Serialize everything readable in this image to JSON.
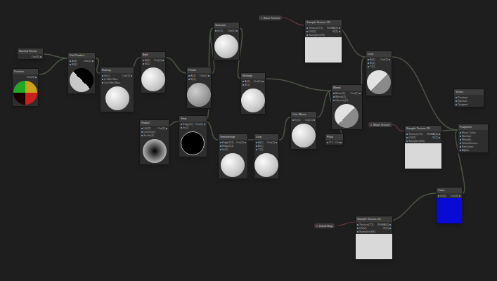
{
  "graph": {
    "nodes": [
      {
        "title": "Normal Vector",
        "ports": [],
        "outputs": [
          "Out(3)"
        ],
        "preview": "none"
      },
      {
        "title": "Position",
        "ports": [],
        "outputs": [
          "Out(3)"
        ],
        "preview": "sphere-color"
      },
      {
        "title": "Dot Product",
        "ports": [
          "A(3)",
          "B(3)"
        ],
        "outputs": [
          "Out(1)"
        ],
        "preview": "sphere-dark-split"
      },
      {
        "title": "Remap",
        "ports": [
          "In(1)",
          "In Min Max",
          "Out Min Max"
        ],
        "outputs": [
          "Out(1)"
        ],
        "preview": "sphere-light"
      },
      {
        "title": "Add",
        "ports": [
          "A(1)",
          "B(1)"
        ],
        "outputs": [
          "Out(1)"
        ],
        "preview": "sphere-light"
      },
      {
        "title": "Power",
        "ports": [
          "A(1)",
          "B(1)"
        ],
        "outputs": [
          "Out(1)"
        ],
        "preview": "sphere-gray"
      },
      {
        "title": "Saturate",
        "ports": [
          "In(1)"
        ],
        "outputs": [
          "Out(1)"
        ],
        "preview": "sphere-light"
      },
      {
        "title": "Multiply",
        "ports": [
          "A(1)",
          "B(1)"
        ],
        "outputs": [
          "Out(1)"
        ],
        "preview": "sphere-light"
      },
      {
        "title": "Radial",
        "ports": [
          "UV(2)",
          "Center(2)",
          "Scale(1)"
        ],
        "outputs": [
          "Out(1)"
        ],
        "preview": "sphere-radial"
      },
      {
        "title": "Step",
        "ports": [
          "Edge(1)",
          "In(1)"
        ],
        "outputs": [
          "Out(1)"
        ],
        "preview": "sphere-black"
      },
      {
        "title": "Smoothstep",
        "ports": [
          "Edge1(1)",
          "Edge2(1)",
          "In(1)"
        ],
        "outputs": [
          "Out(1)"
        ],
        "preview": "sphere-light"
      },
      {
        "title": "Lerp",
        "ports": [
          "A(1)",
          "B(1)",
          "T(1)"
        ],
        "outputs": [
          "Out(1)"
        ],
        "preview": "sphere-light"
      },
      {
        "title": "One Minus",
        "ports": [
          "In(1)"
        ],
        "outputs": [
          "Out(1)"
        ],
        "preview": "sphere-light"
      },
      {
        "title": "Float",
        "ports": [
          "X 1"
        ],
        "outputs": [
          "Out"
        ],
        "preview": "none"
      },
      {
        "title": "Blend",
        "ports": [
          "Base(1)",
          "Blend(1)",
          "Opacity(1)"
        ],
        "outputs": [
          "Out(1)"
        ],
        "preview": "sphere-light-split"
      },
      {
        "title": "Lerp",
        "ports": [
          "A(1)",
          "B(1)",
          "T(1)"
        ],
        "outputs": [
          "Out(1)"
        ],
        "preview": "sphere-light-split"
      },
      {
        "title": "Sample Texture 2D",
        "ports": [
          "Texture(T2)",
          "UV(2)",
          "Sampler(SS)"
        ],
        "outputs": [
          "RGBA(4)",
          "R(1)"
        ],
        "preview": "texture"
      },
      {
        "title": "Sample Texture 2D",
        "ports": [
          "Texture(T2)",
          "UV(2)",
          "Sampler(SS)"
        ],
        "outputs": [
          "RGBA(4)",
          "R(1)"
        ],
        "preview": "texture"
      },
      {
        "title": "Sample Texture 2D",
        "ports": [
          "Texture(T2)",
          "UV(2)",
          "Sampler(SS)"
        ],
        "outputs": [
          "RGBA(4)",
          "R(1)"
        ],
        "preview": "texture"
      },
      {
        "title": "Color",
        "ports": [
          "In(4)"
        ],
        "outputs": [
          "Out(4)"
        ],
        "preview": "swatch",
        "color": "#0a0ad6"
      },
      {
        "title": "Fragment",
        "ports": [
          "Base Color",
          "Normal",
          "Metallic",
          "Smoothness",
          "Emission",
          "Alpha"
        ],
        "outputs": [],
        "preview": "none"
      },
      {
        "title": "Vertex",
        "ports": [
          "Position",
          "Normal",
          "Tangent"
        ],
        "outputs": [],
        "preview": "none"
      }
    ],
    "edges": [
      [
        0,
        2
      ],
      [
        1,
        2
      ],
      [
        2,
        3
      ],
      [
        3,
        4
      ],
      [
        4,
        5
      ],
      [
        5,
        6
      ],
      [
        9,
        6
      ],
      [
        9,
        10
      ],
      [
        6,
        7
      ],
      [
        7,
        14
      ],
      [
        8,
        9
      ],
      [
        10,
        11
      ],
      [
        11,
        12
      ],
      [
        12,
        14
      ],
      [
        13,
        14
      ],
      [
        14,
        15
      ],
      [
        16,
        15
      ],
      [
        15,
        20
      ],
      [
        17,
        20
      ],
      [
        18,
        19
      ],
      [
        19,
        20
      ]
    ],
    "properties": [
      {
        "label": "Base Texture",
        "target": 16
      },
      {
        "label": "Mask Texture",
        "target": 17
      },
      {
        "label": "Detail Map",
        "target": 18
      }
    ]
  }
}
